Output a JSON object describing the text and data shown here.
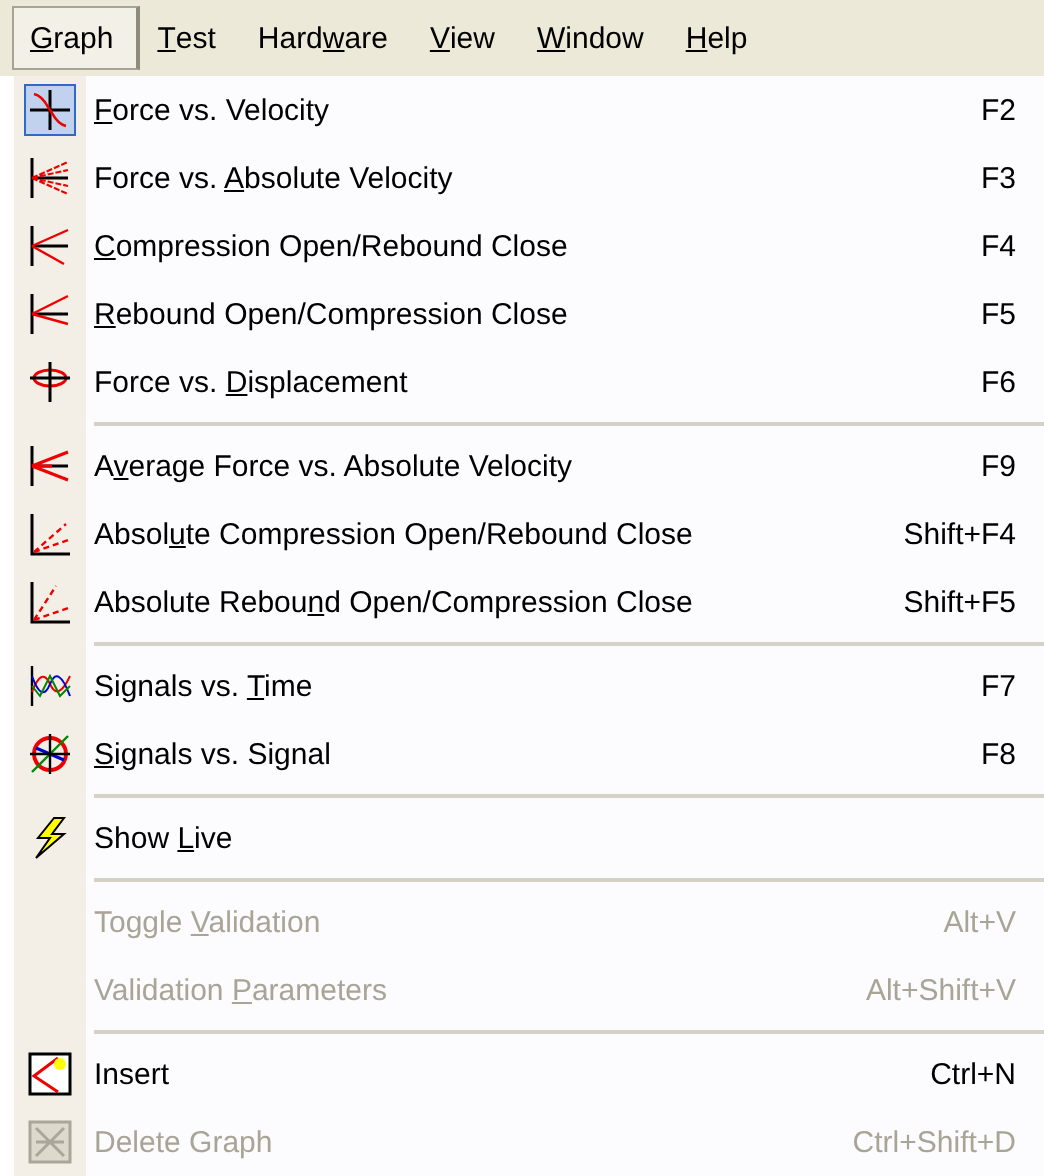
{
  "menu_bar": [
    {
      "access_key": "G",
      "label_end": "raph",
      "selected": true
    },
    {
      "access_key": "T",
      "label_end": "est",
      "selected": false
    },
    {
      "label_start": "Hard",
      "access_key": "w",
      "label_end": "are",
      "selected": false
    },
    {
      "access_key": "V",
      "label_end": "iew",
      "selected": false
    },
    {
      "access_key": "W",
      "label_end": "indow",
      "selected": false
    },
    {
      "access_key": "H",
      "label_end": "elp",
      "selected": false
    }
  ],
  "menu": {
    "items": [
      {
        "kind": "command",
        "access_key": "F",
        "label_end": "orce vs. Velocity",
        "shortcut": "F2",
        "checked": true,
        "disabled": false
      },
      {
        "kind": "command",
        "label_start": "Force vs. ",
        "access_key": "A",
        "label_end": "bsolute Velocity",
        "shortcut": "F3",
        "checked": false,
        "disabled": false
      },
      {
        "kind": "command",
        "access_key": "C",
        "label_end": "ompression Open/Rebound Close",
        "shortcut": "F4",
        "checked": false,
        "disabled": false
      },
      {
        "kind": "command",
        "access_key": "R",
        "label_end": "ebound Open/Compression Close",
        "shortcut": "F5",
        "checked": false,
        "disabled": false
      },
      {
        "kind": "command",
        "label_start": "Force vs. ",
        "access_key": "D",
        "label_end": "isplacement",
        "shortcut": "F6",
        "checked": false,
        "disabled": false
      },
      {
        "kind": "separator"
      },
      {
        "kind": "command",
        "label_start": "A",
        "access_key": "v",
        "label_end": "erage Force vs. Absolute Velocity",
        "shortcut": "F9",
        "checked": false,
        "disabled": false
      },
      {
        "kind": "command",
        "label_start": "Absol",
        "access_key": "u",
        "label_end": "te Compression Open/Rebound Close",
        "shortcut": "Shift+F4",
        "checked": false,
        "disabled": false
      },
      {
        "kind": "command",
        "label_start": "Absolute Rebou",
        "access_key": "n",
        "label_end": "d Open/Compression Close",
        "shortcut": "Shift+F5",
        "checked": false,
        "disabled": false
      },
      {
        "kind": "separator"
      },
      {
        "kind": "command",
        "label_start": "Signals vs. ",
        "access_key": "T",
        "label_end": "ime",
        "shortcut": "F7",
        "checked": false,
        "disabled": false
      },
      {
        "kind": "command",
        "access_key": "S",
        "label_end": "ignals vs. Signal",
        "shortcut": "F8",
        "checked": false,
        "disabled": false
      },
      {
        "kind": "separator"
      },
      {
        "kind": "command",
        "label_start": "Show ",
        "access_key": "L",
        "label_end": "ive",
        "checked": false,
        "disabled": false
      },
      {
        "kind": "separator"
      },
      {
        "kind": "command",
        "label_start": "Toggle ",
        "access_key": "V",
        "label_end": "alidation",
        "shortcut": "Alt+V",
        "checked": false,
        "disabled": true
      },
      {
        "kind": "command",
        "label_start": "Validation ",
        "access_key": "P",
        "label_end": "arameters",
        "shortcut": "Alt+Shift+V",
        "checked": false,
        "disabled": true
      },
      {
        "kind": "separator"
      },
      {
        "kind": "command",
        "label_start": "Insert",
        "shortcut": "Ctrl+N",
        "checked": false,
        "disabled": false
      },
      {
        "kind": "command",
        "label_start": "Delete Graph",
        "shortcut": "Ctrl+Shift+D",
        "checked": false,
        "disabled": true
      }
    ]
  }
}
